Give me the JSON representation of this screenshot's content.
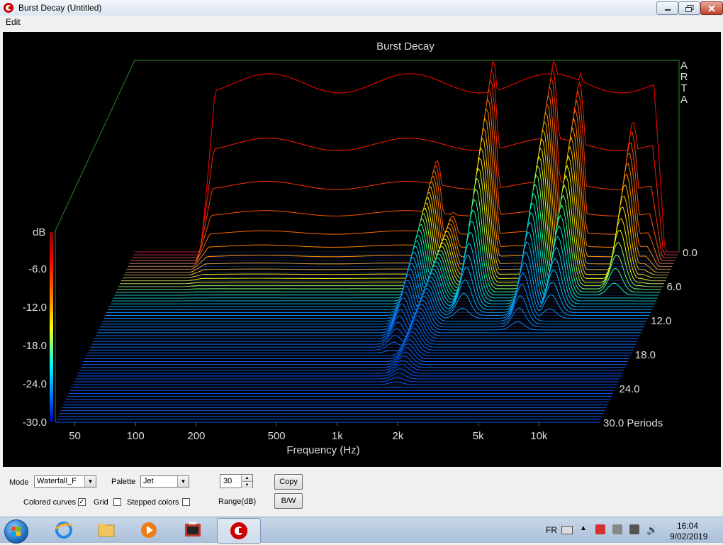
{
  "window": {
    "title": "Burst Decay  (Untitled)"
  },
  "menu": {
    "edit": "Edit"
  },
  "plot": {
    "db_label": "dB",
    "watermark": [
      "A",
      "R",
      "T",
      "A"
    ]
  },
  "chart_data": {
    "type": "waterfall",
    "title": "Burst Decay",
    "xlabel": "Frequency (Hz)",
    "ylabel": "dB",
    "zlabel": "Periods",
    "x_scale": "log",
    "x_ticks": [
      "50",
      "100",
      "200",
      "500",
      "1k",
      "2k",
      "5k",
      "10k"
    ],
    "x_tick_values": [
      50,
      100,
      200,
      500,
      1000,
      2000,
      5000,
      10000
    ],
    "xlim": [
      40,
      20000
    ],
    "y_ticks": [
      "-6.0",
      "-12.0",
      "-18.0",
      "-24.0",
      "-30.0"
    ],
    "y_tick_values": [
      -6,
      -12,
      -18,
      -24,
      -30
    ],
    "ylim": [
      -30,
      0
    ],
    "z_ticks": [
      "0.0",
      "6.0",
      "12.0",
      "18.0",
      "24.0",
      "30.0 Periods"
    ],
    "z_tick_values": [
      0,
      6,
      12,
      18,
      24,
      30
    ],
    "zlim": [
      0,
      30
    ],
    "curve_count": 60,
    "palette": "Jet",
    "colorbar_colors": [
      "#ff0000",
      "#ff8000",
      "#ffff00",
      "#00ffff",
      "#0080ff"
    ],
    "peaks": [
      {
        "freq_hz": 2400,
        "level_db": 0,
        "decay_periods": 12
      },
      {
        "freq_hz": 4800,
        "level_db": 0,
        "decay_periods": 14
      },
      {
        "freq_hz": 6500,
        "level_db": -2,
        "decay_periods": 12
      },
      {
        "freq_hz": 12000,
        "level_db": -8,
        "decay_periods": 8
      },
      {
        "freq_hz": 1300,
        "level_db": -14,
        "decay_periods": 18
      },
      {
        "freq_hz": 1600,
        "level_db": -22,
        "decay_periods": 24
      }
    ]
  },
  "controls": {
    "mode_label": "Mode",
    "mode_value": "Waterfall_F",
    "palette_label": "Palette",
    "palette_value": "Jet",
    "range_value": "30",
    "range_label": "Range(dB)",
    "copy_button": "Copy",
    "bw_button": "B/W",
    "colored_curves_label": "Colored curves",
    "colored_curves_checked": true,
    "grid_label": "Grid",
    "stepped_colors_label": "Stepped colors"
  },
  "taskbar": {
    "language": "FR",
    "time": "16:04",
    "date": "9/02/2019"
  }
}
